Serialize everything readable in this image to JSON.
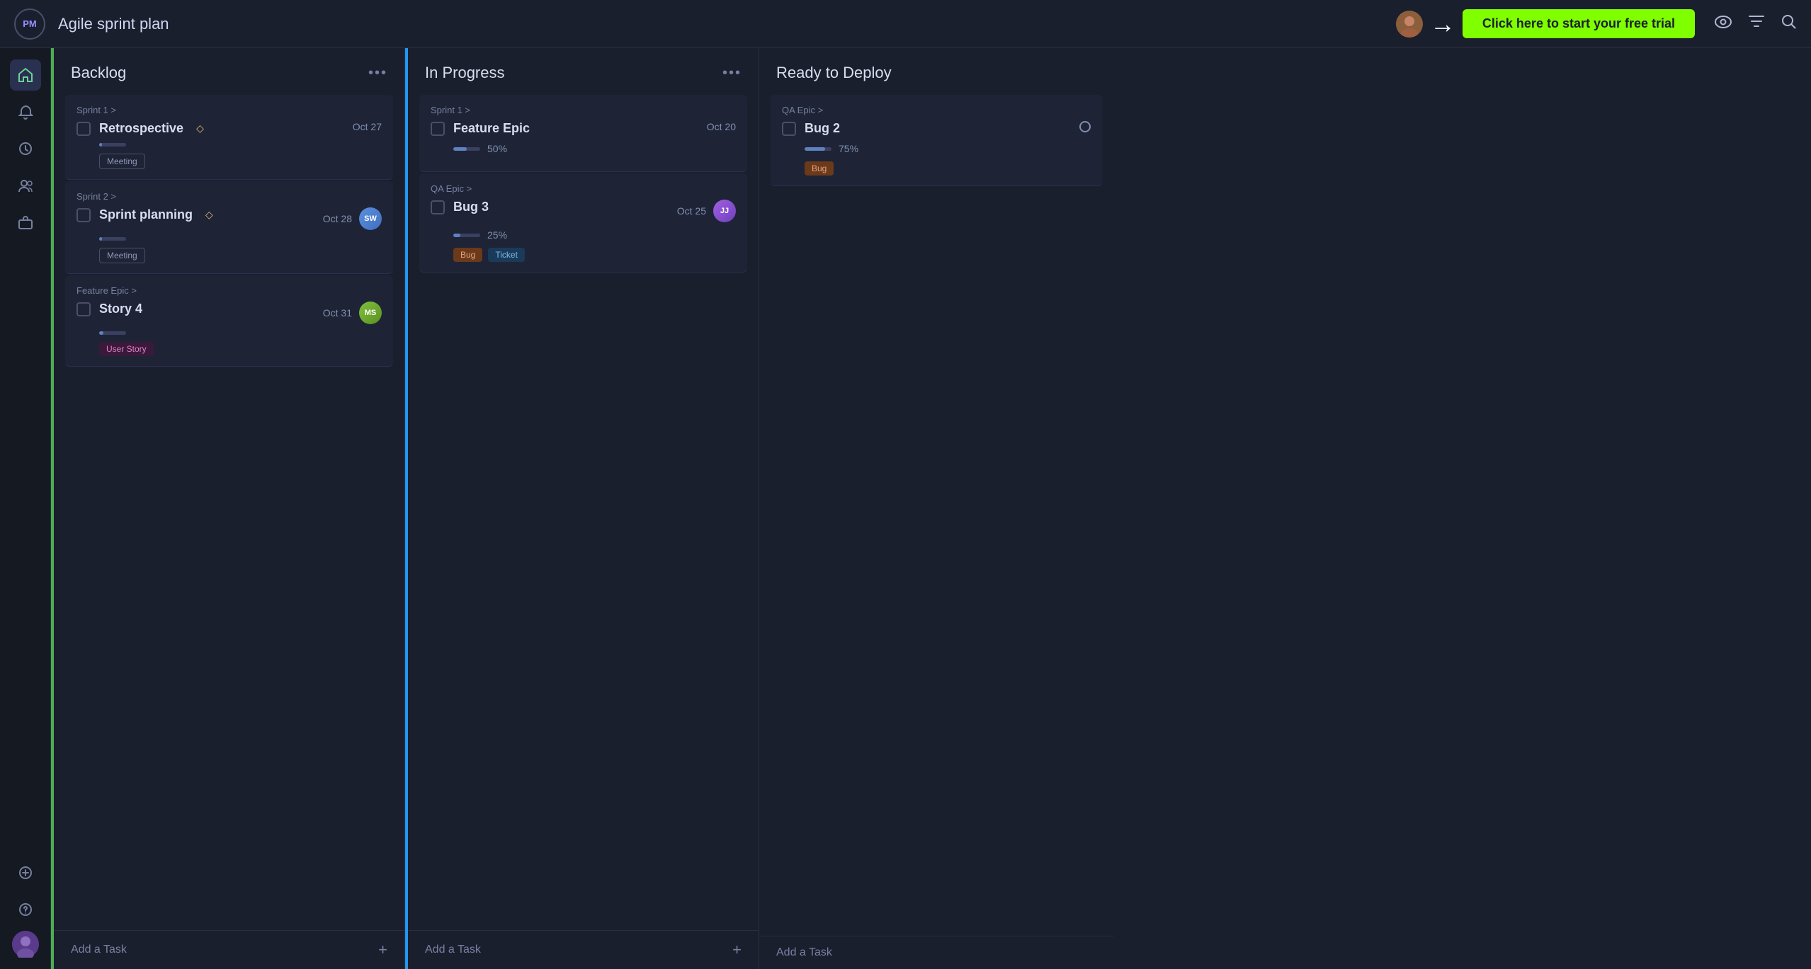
{
  "header": {
    "logo_label": "PM",
    "title": "Agile sprint plan",
    "cta_label": "Click here to start your free trial",
    "icon_eye": "👁",
    "icon_filter": "⧖",
    "icon_search": "🔍"
  },
  "sidebar": {
    "items": [
      {
        "icon": "🏠",
        "label": "home",
        "active": true
      },
      {
        "icon": "🔔",
        "label": "notifications",
        "active": false
      },
      {
        "icon": "🕐",
        "label": "recent",
        "active": false
      },
      {
        "icon": "👤",
        "label": "people",
        "active": false
      },
      {
        "icon": "💼",
        "label": "portfolio",
        "active": false
      },
      {
        "icon": "➕",
        "label": "add",
        "active": false
      },
      {
        "icon": "❓",
        "label": "help",
        "active": false
      }
    ],
    "bottom_avatar_label": "Me"
  },
  "columns": [
    {
      "id": "backlog",
      "title": "Backlog",
      "menu_label": "•••",
      "accent": "green",
      "cards": [
        {
          "epic": "Sprint 1 >",
          "title": "Retrospective",
          "has_diamond": true,
          "date": "Oct 27",
          "progress": 10,
          "tags": [
            "Meeting"
          ],
          "avatar": null
        },
        {
          "epic": "Sprint 2 >",
          "title": "Sprint planning",
          "has_diamond": true,
          "date": "Oct 28",
          "progress": 10,
          "tags": [
            "Meeting"
          ],
          "avatar": "SW"
        },
        {
          "epic": "Feature Epic >",
          "title": "Story 4",
          "has_diamond": false,
          "date": "Oct 31",
          "progress": 15,
          "tags": [
            "User Story"
          ],
          "avatar": "MS"
        }
      ],
      "add_task_label": "Add a Task"
    },
    {
      "id": "inprogress",
      "title": "In Progress",
      "menu_label": "•••",
      "accent": "blue",
      "cards": [
        {
          "epic": "Sprint 1 >",
          "title": "Feature Epic",
          "has_diamond": false,
          "date": "Oct 20",
          "progress": 50,
          "progress_label": "50%",
          "tags": [],
          "avatar": null
        },
        {
          "epic": "QA Epic >",
          "title": "Bug 3",
          "has_diamond": false,
          "date": "Oct 25",
          "progress": 25,
          "progress_label": "25%",
          "tags": [
            "Bug",
            "Ticket"
          ],
          "avatar": "JJ"
        }
      ],
      "add_task_label": "Add a Task"
    },
    {
      "id": "readytodeploy",
      "title": "Ready to Deploy",
      "menu_label": null,
      "accent": null,
      "cards": [
        {
          "epic": "QA Epic >",
          "title": "Bug 2",
          "has_diamond": false,
          "date": null,
          "progress": 75,
          "progress_label": "75%",
          "tags": [
            "Bug"
          ],
          "avatar": null
        }
      ],
      "add_task_label": "Add a Task"
    }
  ]
}
